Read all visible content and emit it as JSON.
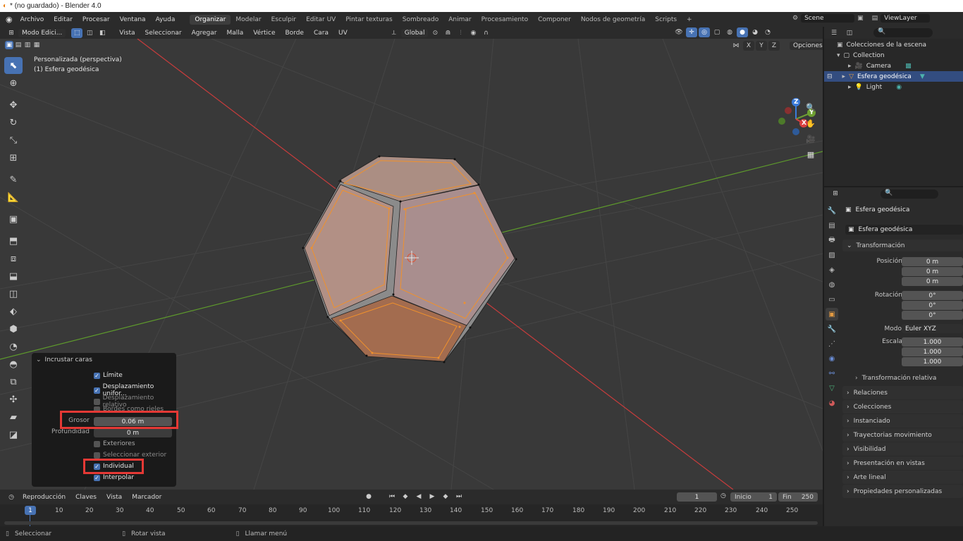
{
  "titlebar": {
    "title": "* (no guardado) - Blender 4.0"
  },
  "menubar": {
    "menus": [
      "Archivo",
      "Editar",
      "Procesar",
      "Ventana",
      "Ayuda"
    ],
    "workspaces": [
      "Organizar",
      "Modelar",
      "Esculpir",
      "Editar UV",
      "Pintar texturas",
      "Sombreado",
      "Animar",
      "Procesamiento",
      "Componer",
      "Nodos de geometría",
      "Scripts"
    ],
    "add_tab": "+",
    "scene": "Scene",
    "view_layer": "ViewLayer"
  },
  "viewport_header": {
    "mode": "Modo Edici...",
    "menus": [
      "Vista",
      "Seleccionar",
      "Agregar",
      "Malla",
      "Vértice",
      "Borde",
      "Cara",
      "UV"
    ],
    "orientation": "Global",
    "axis_x": "X",
    "axis_y": "Y",
    "axis_z": "Z",
    "options": "Opciones"
  },
  "viewport": {
    "view_name": "Personalizada (perspectiva)",
    "object_name": "(1) Esfera geodésica",
    "gizmo_x": "X",
    "gizmo_y": "Y",
    "gizmo_z": "Z"
  },
  "operator_panel": {
    "title": "Incrustar caras",
    "limite": "Límite",
    "desplazamiento_uniforme": "Desplazamiento unifor...",
    "desplazamiento_relativo": "Desplazamiento relativo",
    "bordes_como_rieles": "Bordes como rieles",
    "grosor_label": "Grosor",
    "grosor_value": "0.06 m",
    "profundidad_label": "Profundidad",
    "profundidad_value": "0 m",
    "exteriores": "Exteriores",
    "seleccionar_exterior": "Seleccionar exterior",
    "individual": "Individual",
    "interpolar": "Interpolar",
    "checks": {
      "limite": true,
      "desplazamiento_uniforme": true,
      "desplazamiento_relativo": false,
      "bordes_como_rieles": false,
      "exteriores": false,
      "seleccionar_exterior": false,
      "individual": true,
      "interpolar": true
    }
  },
  "timeline": {
    "menus": [
      "Reproducción",
      "Claves",
      "Vista",
      "Marcador"
    ],
    "current_frame": "1",
    "start_label": "Inicio",
    "start_value": "1",
    "end_label": "Fin",
    "end_value": "250",
    "ruler": [
      "1",
      "10",
      "20",
      "30",
      "40",
      "50",
      "60",
      "70",
      "80",
      "90",
      "100",
      "110",
      "120",
      "130",
      "140",
      "150",
      "160",
      "170",
      "180",
      "190",
      "200",
      "210",
      "220",
      "230",
      "240",
      "250"
    ],
    "playhead_label": "1"
  },
  "statusbar": {
    "select": "Seleccionar",
    "rotate": "Rotar vista",
    "menu": "Llamar menú"
  },
  "outliner": {
    "root": "Colecciones de la escena",
    "collection": "Collection",
    "items": [
      {
        "name": "Camera",
        "selected": false
      },
      {
        "name": "Esfera geodésica",
        "selected": true
      },
      {
        "name": "Light",
        "selected": false
      }
    ]
  },
  "properties": {
    "object_name": "Esfera geodésica",
    "datablock": "Esfera geodésica",
    "transform_header": "Transformación",
    "pos_label": "Posición X",
    "pos_x": "0 m",
    "pos_y": "0 m",
    "pos_z": "0 m",
    "rot_label": "Rotación X",
    "rot_x": "0°",
    "rot_y": "0°",
    "rot_z": "0°",
    "mode_label": "Modo",
    "mode_value": "Euler XYZ",
    "scale_label": "Escala X",
    "scale_x": "1.000",
    "scale_y": "1.000",
    "scale_z": "1.000",
    "y_label": "Y",
    "z_label": "Z",
    "delta": "Transformación relativa",
    "sections": [
      "Relaciones",
      "Colecciones",
      "Instanciado",
      "Trayectorias movimiento",
      "Visibilidad",
      "Presentación en vistas",
      "Arte lineal",
      "Propiedades personalizadas"
    ]
  }
}
